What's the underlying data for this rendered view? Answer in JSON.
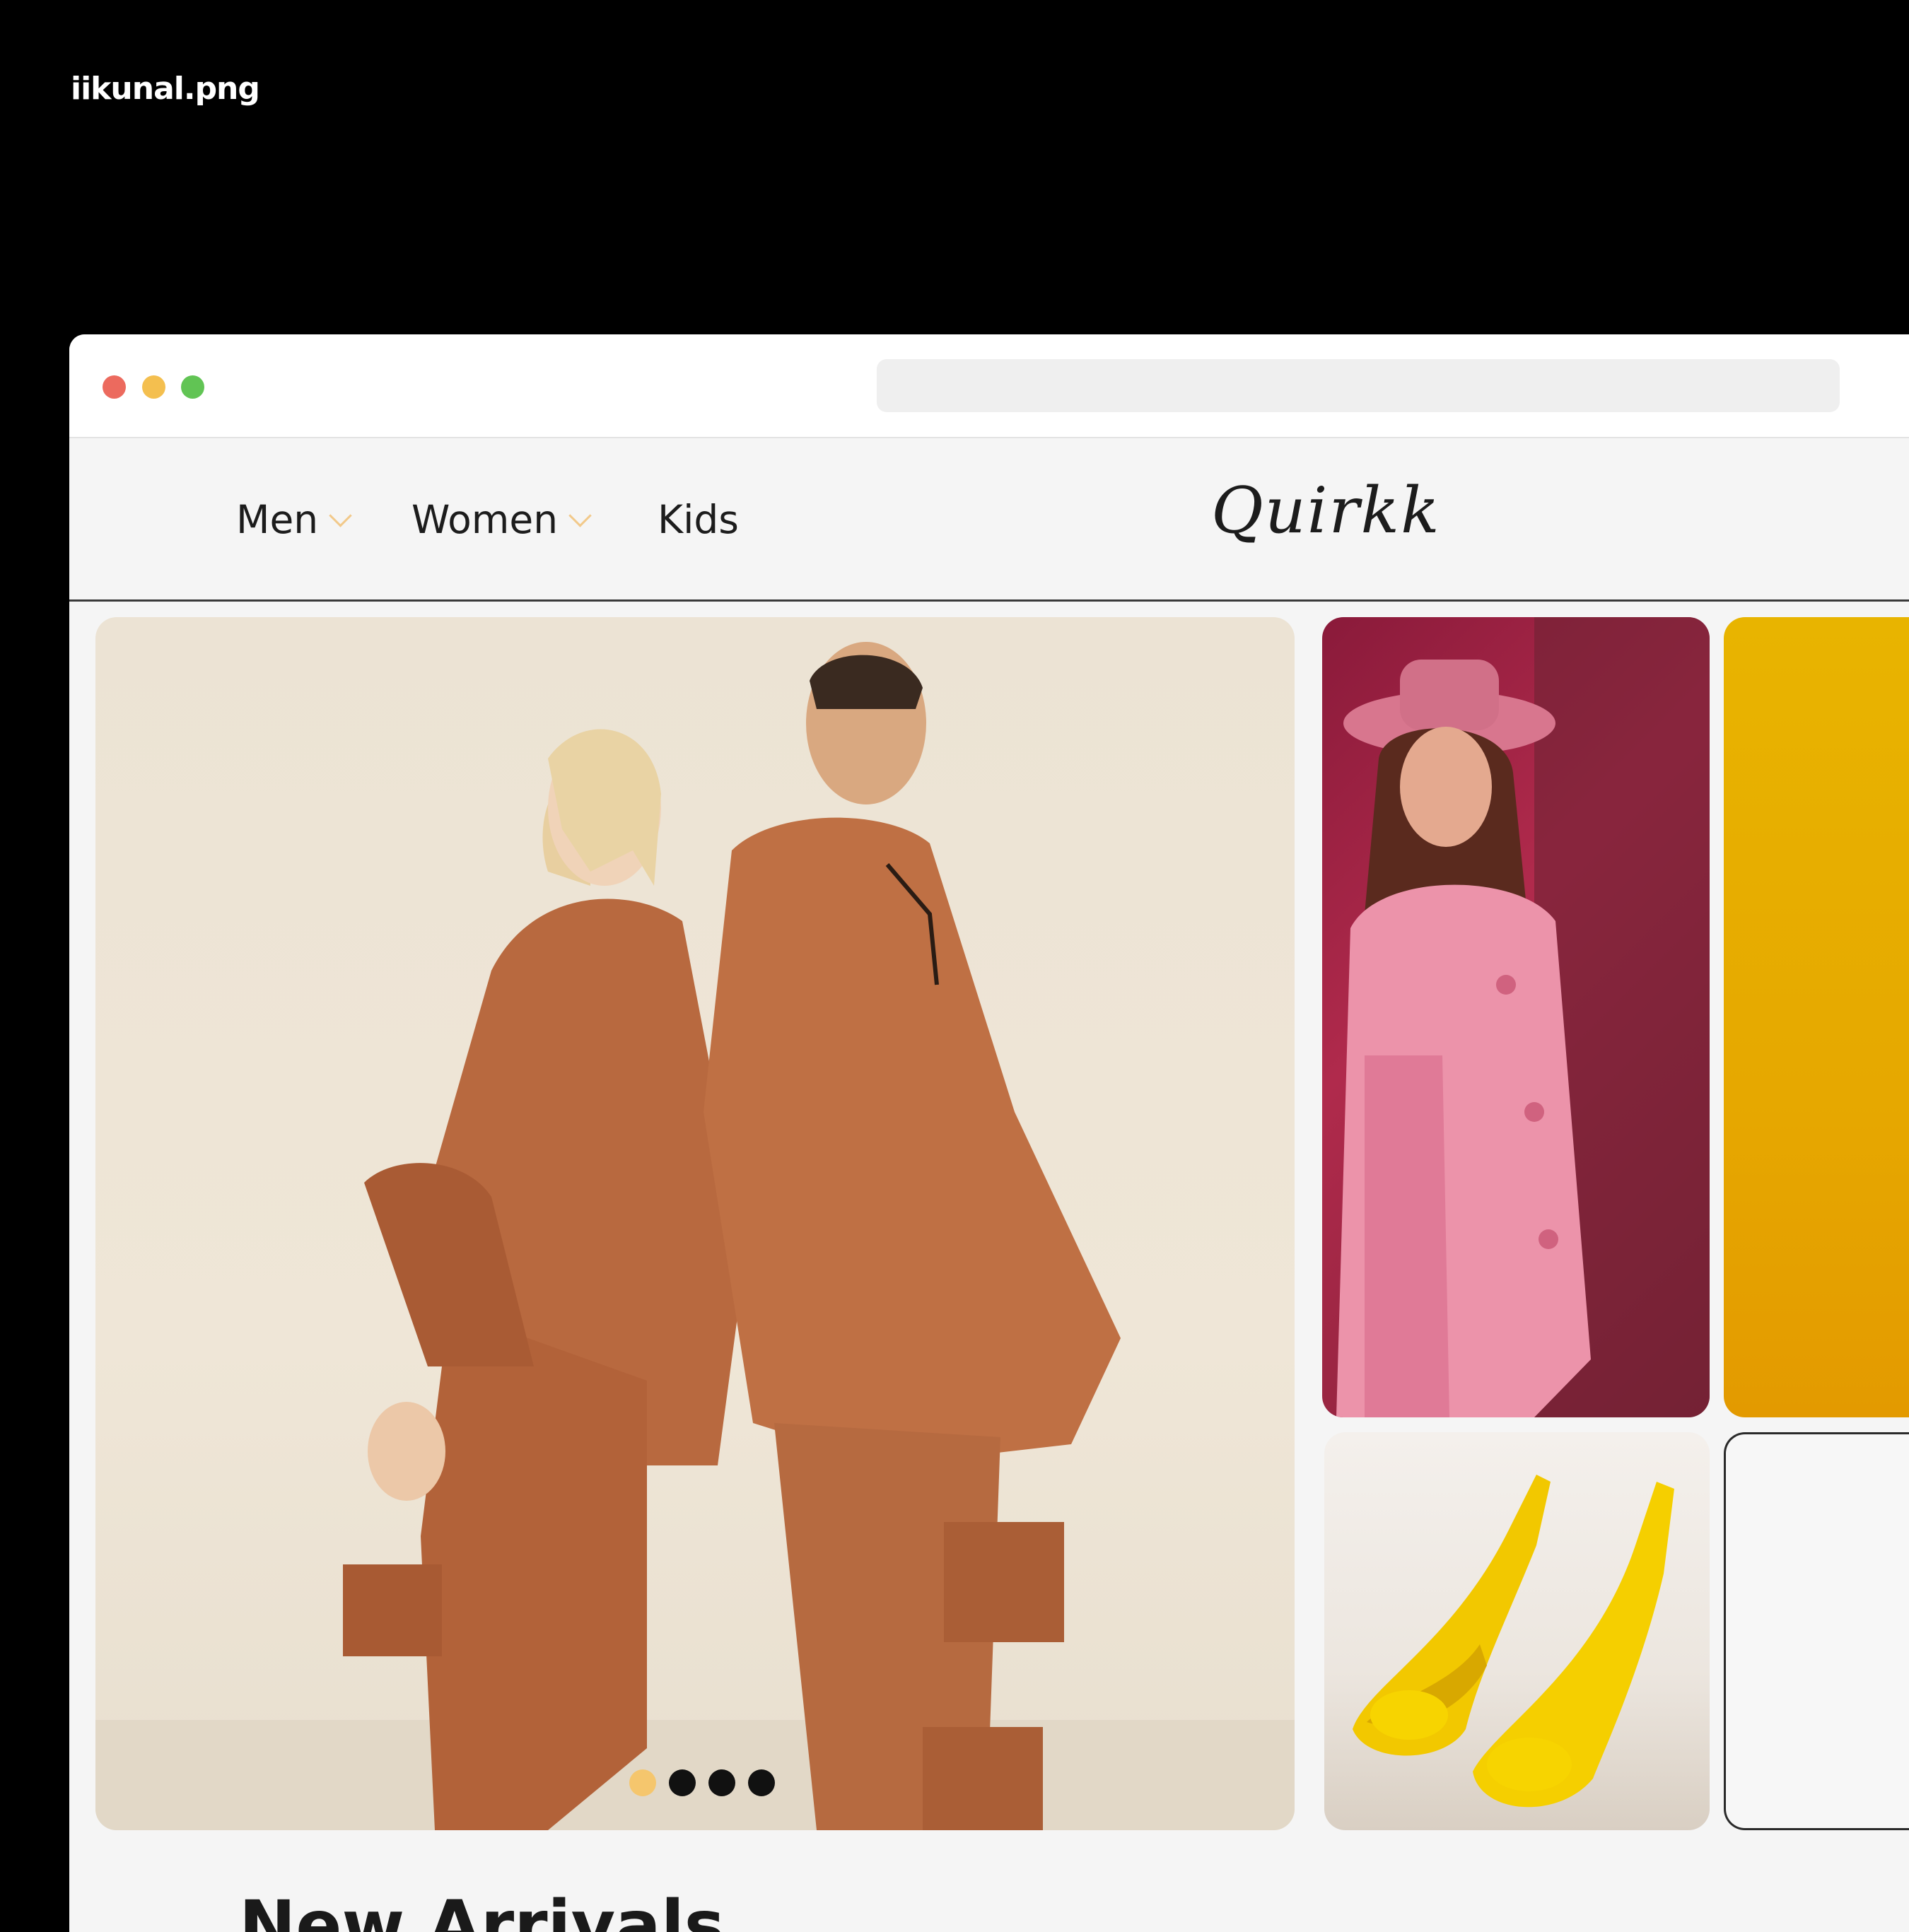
{
  "file_label": "iikunal.png",
  "nav": {
    "items": [
      {
        "label": "Men",
        "has_dropdown": true
      },
      {
        "label": "Women",
        "has_dropdown": true
      },
      {
        "label": "Kids",
        "has_dropdown": false
      }
    ],
    "logo": "Quirkk"
  },
  "carousel": {
    "slide_count": 4,
    "active_index": 0
  },
  "section_title": "New Arrivals",
  "colors": {
    "accent": "#f5c66d",
    "hoodie": "#b8693f",
    "pink_tile": "#a3264a",
    "yellow_tile": "#e6a800"
  }
}
